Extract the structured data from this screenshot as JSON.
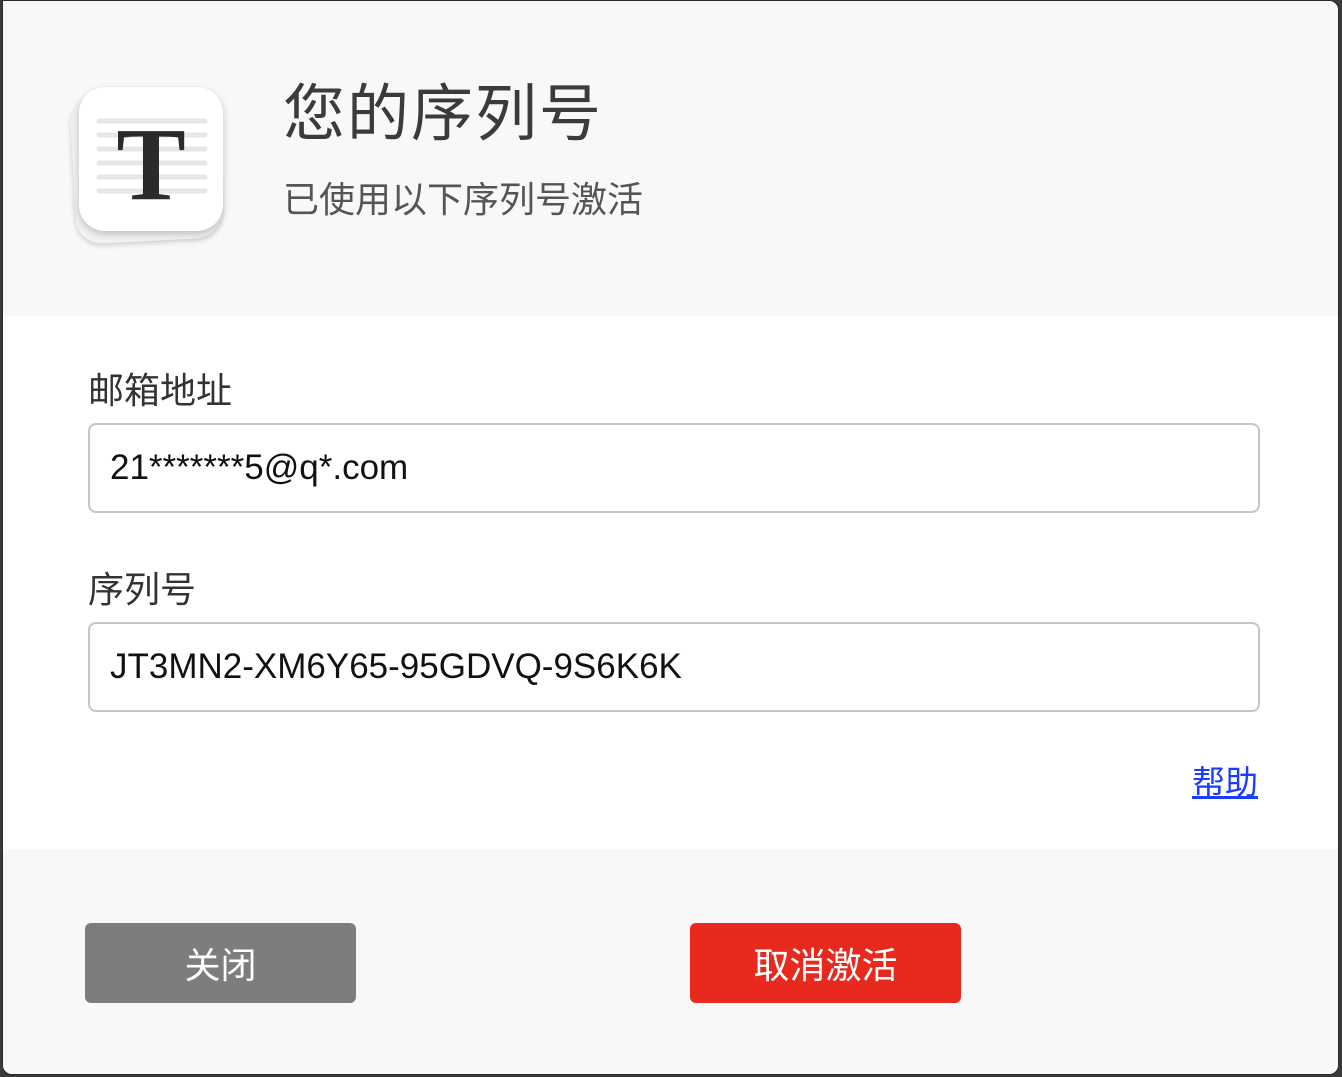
{
  "header": {
    "title": "您的序列号",
    "subtitle": "已使用以下序列号激活",
    "app_icon": "typora-T-icon"
  },
  "form": {
    "email_label": "邮箱地址",
    "email_value": "21*******5@q*.com",
    "serial_label": "序列号",
    "serial_value": "JT3MN2-XM6Y65-95GDVQ-9S6K6K",
    "help_link": "帮助"
  },
  "footer": {
    "close_label": "关闭",
    "deactivate_label": "取消激活"
  },
  "colors": {
    "deactivate_button": "#e8291e",
    "close_button": "#7d7d7d",
    "link": "#1a3cff"
  }
}
